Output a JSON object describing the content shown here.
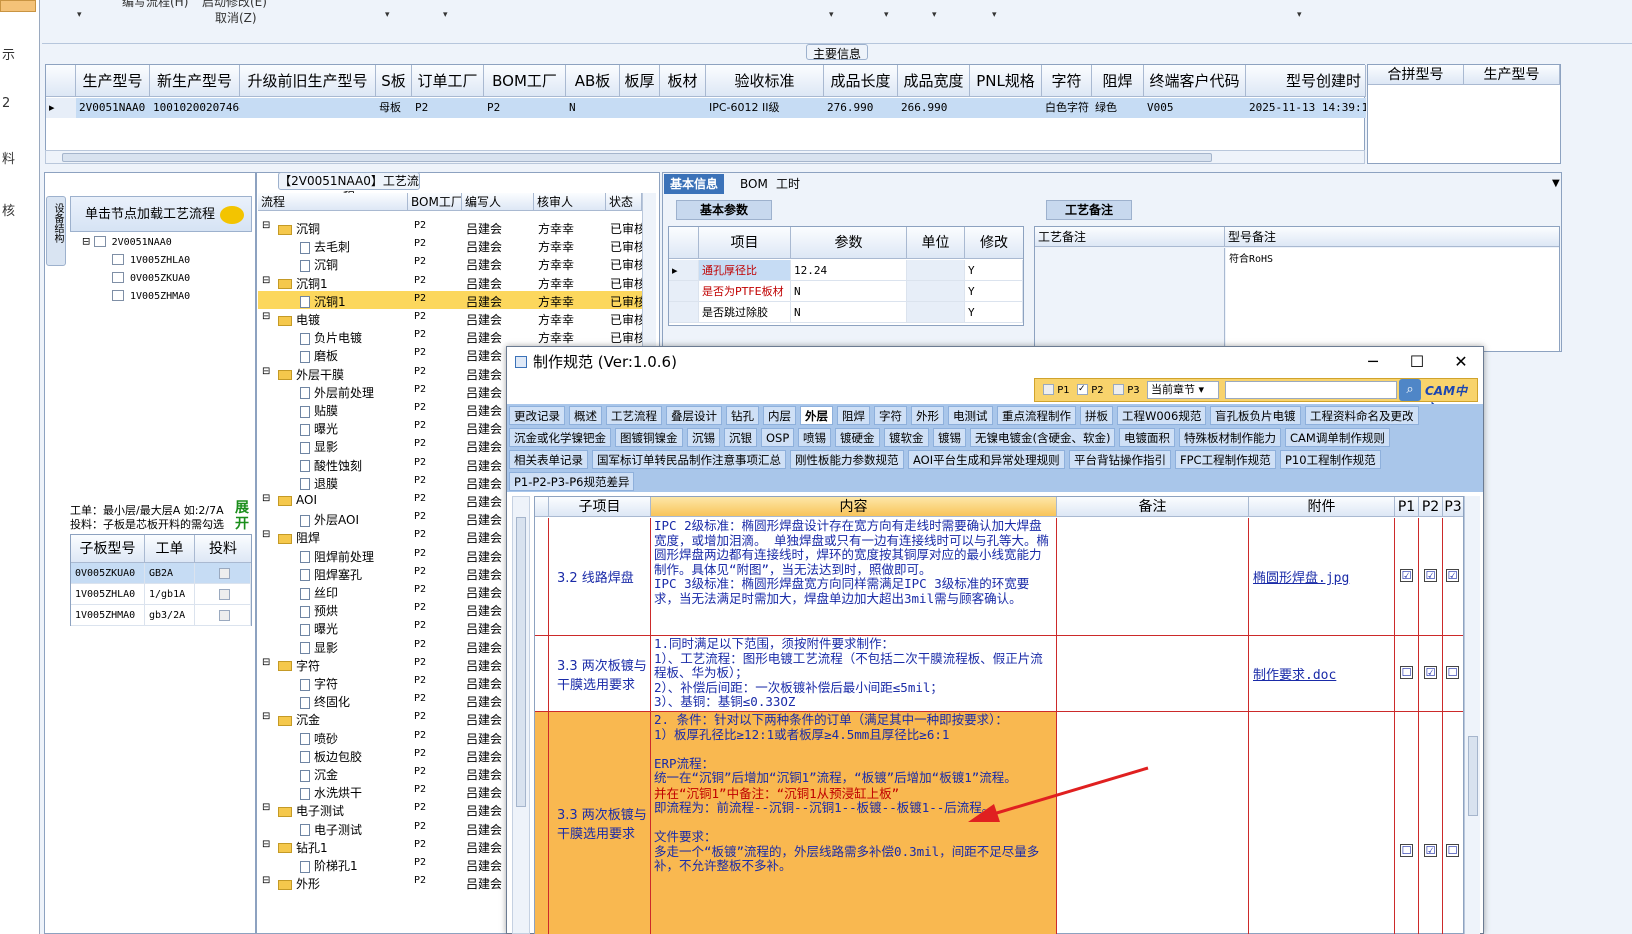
{
  "left_strip": {
    "labels": [
      "示",
      "2",
      "料",
      "核"
    ]
  },
  "toolbar": {
    "label1": "编写流程(H)",
    "label2": "启动修改(E)",
    "label3": "取消(Z)"
  },
  "main_info": {
    "section_label": "主要信息",
    "columns": [
      "生产型号",
      "新生产型号",
      "升级前旧生产型号",
      "S板",
      "订单工厂",
      "BOM工厂",
      "AB板",
      "板厚",
      "板材",
      "验收标准",
      "成品长度",
      "成品宽度",
      "PNL规格",
      "字符",
      "阻焊",
      "终端客户代码",
      "型号创建时"
    ],
    "row": [
      "2V0051NAA0",
      "10010200207468",
      "",
      "母板",
      "P2",
      "P2",
      "N",
      "",
      "",
      "IPC-6012 II级",
      "276.990",
      "266.990",
      "",
      "白色字符",
      "绿色",
      "V005",
      "2025-11-13 14:39:18"
    ],
    "merge_columns": [
      "合拼型号",
      "生产型号"
    ]
  },
  "left_panel": {
    "vertical_tab": "设备结构",
    "load_header": "单击节点加载工艺流程",
    "tree": [
      "2V0051NAA0",
      "1V005ZHLA0",
      "0V005ZKUA0",
      "1V005ZHMA0"
    ],
    "layer_line1": "工单：最小层/最大层A 如:2/7A",
    "layer_line2": "投料：子板是芯板开料的需勾选",
    "unfold_label": "展开",
    "sub_columns": [
      "子板型号",
      "工单",
      "投料"
    ],
    "sub_rows": [
      [
        "0V005ZKUA0",
        "GB2A"
      ],
      [
        "1V005ZHLA0",
        "1/gb1A"
      ],
      [
        "1V005ZHMA0",
        "gb3/2A"
      ]
    ]
  },
  "process": {
    "title": "【2V0051NAA0】工艺流程",
    "columns": [
      "流程",
      "BOM工厂",
      "编写人",
      "核审人",
      "状态"
    ],
    "rows": [
      {
        "name": "沉铜",
        "lvl": 1,
        "bom": "P2",
        "writer": "吕建会",
        "reviewer": "方幸幸",
        "status": "已审核"
      },
      {
        "name": "去毛刺",
        "lvl": 2,
        "bom": "P2",
        "writer": "吕建会",
        "reviewer": "方幸幸",
        "status": "已审核"
      },
      {
        "name": "沉铜",
        "lvl": 2,
        "bom": "P2",
        "writer": "吕建会",
        "reviewer": "方幸幸",
        "status": "已审核"
      },
      {
        "name": "沉铜1",
        "lvl": 1,
        "bom": "P2",
        "writer": "吕建会",
        "reviewer": "方幸幸",
        "status": "已审核"
      },
      {
        "name": "沉铜1",
        "lvl": 2,
        "bom": "P2",
        "writer": "吕建会",
        "reviewer": "方幸幸",
        "status": "已审核",
        "selected": true
      },
      {
        "name": "电镀",
        "lvl": 1,
        "bom": "P2",
        "writer": "吕建会",
        "reviewer": "方幸幸",
        "status": "已审核"
      },
      {
        "name": "负片电镀",
        "lvl": 2,
        "bom": "P2",
        "writer": "吕建会",
        "reviewer": "方幸幸",
        "status": "已审核"
      },
      {
        "name": "磨板",
        "lvl": 2,
        "bom": "P2",
        "writer": "吕建会",
        "reviewer": "",
        "status": ""
      },
      {
        "name": "外层干膜",
        "lvl": 1,
        "bom": "P2",
        "writer": "吕建会",
        "reviewer": "",
        "status": ""
      },
      {
        "name": "外层前处理",
        "lvl": 2,
        "bom": "P2",
        "writer": "吕建会",
        "reviewer": "",
        "status": ""
      },
      {
        "name": "贴膜",
        "lvl": 2,
        "bom": "P2",
        "writer": "吕建会",
        "reviewer": "",
        "status": ""
      },
      {
        "name": "曝光",
        "lvl": 2,
        "bom": "P2",
        "writer": "吕建会",
        "reviewer": "",
        "status": ""
      },
      {
        "name": "显影",
        "lvl": 2,
        "bom": "P2",
        "writer": "吕建会",
        "reviewer": "",
        "status": ""
      },
      {
        "name": "酸性蚀刻",
        "lvl": 2,
        "bom": "P2",
        "writer": "吕建会",
        "reviewer": "",
        "status": ""
      },
      {
        "name": "退膜",
        "lvl": 2,
        "bom": "P2",
        "writer": "吕建会",
        "reviewer": "",
        "status": ""
      },
      {
        "name": "AOI",
        "lvl": 1,
        "bom": "P2",
        "writer": "吕建会",
        "reviewer": "",
        "status": ""
      },
      {
        "name": "外层AOI",
        "lvl": 2,
        "bom": "P2",
        "writer": "吕建会",
        "reviewer": "",
        "status": ""
      },
      {
        "name": "阻焊",
        "lvl": 1,
        "bom": "P2",
        "writer": "吕建会",
        "reviewer": "",
        "status": ""
      },
      {
        "name": "阻焊前处理",
        "lvl": 2,
        "bom": "P2",
        "writer": "吕建会",
        "reviewer": "",
        "status": ""
      },
      {
        "name": "阻焊塞孔",
        "lvl": 2,
        "bom": "P2",
        "writer": "吕建会",
        "reviewer": "",
        "status": ""
      },
      {
        "name": "丝印",
        "lvl": 2,
        "bom": "P2",
        "writer": "吕建会",
        "reviewer": "",
        "status": ""
      },
      {
        "name": "预烘",
        "lvl": 2,
        "bom": "P2",
        "writer": "吕建会",
        "reviewer": "",
        "status": ""
      },
      {
        "name": "曝光",
        "lvl": 2,
        "bom": "P2",
        "writer": "吕建会",
        "reviewer": "",
        "status": ""
      },
      {
        "name": "显影",
        "lvl": 2,
        "bom": "P2",
        "writer": "吕建会",
        "reviewer": "",
        "status": ""
      },
      {
        "name": "字符",
        "lvl": 1,
        "bom": "P2",
        "writer": "吕建会",
        "reviewer": "",
        "status": ""
      },
      {
        "name": "字符",
        "lvl": 2,
        "bom": "P2",
        "writer": "吕建会",
        "reviewer": "",
        "status": ""
      },
      {
        "name": "终固化",
        "lvl": 2,
        "bom": "P2",
        "writer": "吕建会",
        "reviewer": "",
        "status": ""
      },
      {
        "name": "沉金",
        "lvl": 1,
        "bom": "P2",
        "writer": "吕建会",
        "reviewer": "",
        "status": ""
      },
      {
        "name": "喷砂",
        "lvl": 2,
        "bom": "P2",
        "writer": "吕建会",
        "reviewer": "",
        "status": ""
      },
      {
        "name": "板边包胶",
        "lvl": 2,
        "bom": "P2",
        "writer": "吕建会",
        "reviewer": "",
        "status": ""
      },
      {
        "name": "沉金",
        "lvl": 2,
        "bom": "P2",
        "writer": "吕建会",
        "reviewer": "",
        "status": ""
      },
      {
        "name": "水洗烘干",
        "lvl": 2,
        "bom": "P2",
        "writer": "吕建会",
        "reviewer": "",
        "status": ""
      },
      {
        "name": "电子测试",
        "lvl": 1,
        "bom": "P2",
        "writer": "吕建会",
        "reviewer": "",
        "status": ""
      },
      {
        "name": "电子测试",
        "lvl": 2,
        "bom": "P2",
        "writer": "吕建会",
        "reviewer": "",
        "status": ""
      },
      {
        "name": "钻孔1",
        "lvl": 1,
        "bom": "P2",
        "writer": "吕建会",
        "reviewer": "",
        "status": ""
      },
      {
        "name": "阶梯孔1",
        "lvl": 2,
        "bom": "P2",
        "writer": "吕建会",
        "reviewer": "",
        "status": ""
      },
      {
        "name": "外形",
        "lvl": 1,
        "bom": "P2",
        "writer": "吕建会",
        "reviewer": "",
        "status": ""
      }
    ]
  },
  "right_tabs": [
    "基本信息",
    "BOM",
    "工时"
  ],
  "basic_params": {
    "tab": "基本参数",
    "columns": [
      "项目",
      "参数",
      "单位",
      "修改"
    ],
    "rows": [
      {
        "item": "通孔厚径比",
        "param": "12.24",
        "unit": "",
        "mod": "Y",
        "red": true
      },
      {
        "item": "是否为PTFE板材",
        "param": "N",
        "unit": "",
        "mod": "Y",
        "red": true
      },
      {
        "item": "是否跳过除胶",
        "param": "N",
        "unit": "",
        "mod": "Y",
        "red": false
      }
    ]
  },
  "remarks": {
    "tab": "工艺备注",
    "columns": [
      "工艺备注",
      "型号备注"
    ],
    "model_remark": "符合RoHS"
  },
  "dialog": {
    "title": "制作规范 (Ver:1.0.6)",
    "filter": {
      "p1": "P1",
      "p2": "P2",
      "p3": "P3",
      "chapter": "当前章节",
      "search": "",
      "cam": "CAM中心"
    },
    "tabs_row1": [
      "更改记录",
      "概述",
      "工艺流程",
      "叠层设计",
      "钻孔",
      "内层",
      "外层",
      "阻焊",
      "字符",
      "外形",
      "电测试",
      "重点流程制作",
      "拼板",
      "工程W006规范",
      "盲孔板负片电镀",
      "工程资料命名及更改"
    ],
    "tabs_row2": [
      "沉金或化学镍钯金",
      "图镀铜镍金",
      "沉锡",
      "沉银",
      "OSP",
      "喷锡",
      "镀硬金",
      "镀软金",
      "镀锡",
      "无镍电镀金(含硬金、软金)",
      "电镀面积",
      "特殊板材制作能力",
      "CAM调单制作规则"
    ],
    "tabs_row3": [
      "相关表单记录",
      "国军标订单转民品制作注意事项汇总",
      "刚性板能力参数规范",
      "AOI平台生成和异常处理规则",
      "平台背钻操作指引",
      "FPC工程制作规范",
      "P10工程制作规范"
    ],
    "tabs_row4": [
      "P1-P2-P3-P6规范差异"
    ],
    "grid_columns": [
      "子项目",
      "内容",
      "备注",
      "附件",
      "P1",
      "P2",
      "P3"
    ],
    "rows": [
      {
        "sub": "3.2 线路焊盘",
        "content": "IPC 2级标准：椭圆形焊盘设计存在宽方向有走线时需要确认加大焊盘宽度，或增加泪滴。 单独焊盘或只有一边有连接线时可以与孔等大。椭圆形焊盘两边都有连接线时，焊环的宽度按其铜厚对应的最小线宽能力制作。具体见“附图”，当无法达到时，照做即可。\nIPC 3级标准：椭圆形焊盘宽方向同样需满足IPC 3级标准的环宽要求，当无法满足时需加大，焊盘单边加大超出3mil需与顾客确认。",
        "note": "",
        "attach": "椭圆形焊盘.jpg",
        "p": [
          "☑",
          "☑",
          "☑"
        ]
      },
      {
        "sub": "3.3 两次板镀与干膜选用要求",
        "content": "1.同时满足以下范围，须按附件要求制作：\n1）、工艺流程：图形电镀工艺流程（不包括二次干膜流程板、假正片流程板、华为板）；\n2）、补偿后间距：一次板镀补偿后最小间距≤5mil；\n3）、基铜：基铜≤0.33OZ",
        "note": "",
        "attach": "制作要求.doc",
        "p": [
          "☐",
          "☑",
          "☐"
        ]
      },
      {
        "sub": "3.3 两次板镀与干膜选用要求",
        "content_a": "2. 条件：针对以下两种条件的订单（满足其中一种即按要求）：\n1）板厚孔径比≥12:1或者板厚≥4.5mm且厚径比≥6:1\n\nERP流程：\n统一在“沉铜”后增加“沉铜1”流程，“板镀”后增加“板镀1”流程。",
        "content_b": "并在“沉铜1”中备注：“沉铜1从预浸缸上板”",
        "content_c": "即流程为：前流程--沉铜--沉铜1--板镀--板镀1--后流程。\n\n文件要求：\n多走一个“板镀”流程的，外层线路需多补偿0.3mil，间距不足尽量多补，不允许整板不多补。",
        "note": "",
        "attach": "",
        "p": [
          "☐",
          "☑",
          "☐"
        ]
      }
    ]
  },
  "colors": {
    "accent": "#3b72b8",
    "selected_row": "#fcd75d",
    "highlight_row": "#f9b850",
    "arrow": "#e02020"
  }
}
